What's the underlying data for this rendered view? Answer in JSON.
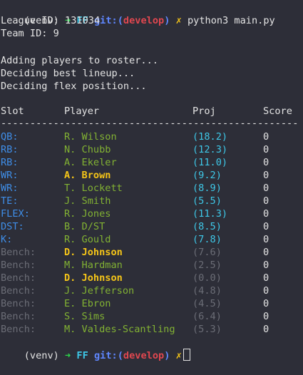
{
  "colors": {
    "background": "#2d2e38",
    "text": "#e4e4e4",
    "slot_active": "#3f8ee8",
    "slot_bench": "#6b6d76",
    "player_normal": "#82b233",
    "player_highlight": "#f5c518",
    "proj_active": "#3ec8e8",
    "proj_bench": "#6b6d76"
  },
  "prompt": {
    "venv": "(venv)",
    "arrow": "➜",
    "dir": "FF",
    "git_prefix": "git:(",
    "branch": "develop",
    "git_suffix": ")",
    "dirty": "✗",
    "command": "python3 main.py"
  },
  "info": {
    "league": "League ID: 131034",
    "team": "Team ID: 9"
  },
  "messages": [
    "Adding players to roster...",
    "Deciding best lineup...",
    "Deciding flex position..."
  ],
  "table": {
    "headers": {
      "slot": "Slot",
      "player": "Player",
      "proj": "Proj",
      "score": "Score"
    },
    "separator": "----------------------------------------------------",
    "rows": [
      {
        "slot": "QB:",
        "player": "R. Wilson",
        "proj": "(18.2)",
        "score": "0",
        "bench": false,
        "highlight": false
      },
      {
        "slot": "RB:",
        "player": "N. Chubb",
        "proj": "(12.3)",
        "score": "0",
        "bench": false,
        "highlight": false
      },
      {
        "slot": "RB:",
        "player": "A. Ekeler",
        "proj": "(11.0)",
        "score": "0",
        "bench": false,
        "highlight": false
      },
      {
        "slot": "WR:",
        "player": "A. Brown",
        "proj": "(9.2)",
        "score": "0",
        "bench": false,
        "highlight": true
      },
      {
        "slot": "WR:",
        "player": "T. Lockett",
        "proj": "(8.9)",
        "score": "0",
        "bench": false,
        "highlight": false
      },
      {
        "slot": "TE:",
        "player": "J. Smith",
        "proj": "(5.5)",
        "score": "0",
        "bench": false,
        "highlight": false
      },
      {
        "slot": "FLEX:",
        "player": "R. Jones",
        "proj": "(11.3)",
        "score": "0",
        "bench": false,
        "highlight": false
      },
      {
        "slot": "DST:",
        "player": "B. D/ST",
        "proj": "(8.5)",
        "score": "0",
        "bench": false,
        "highlight": false
      },
      {
        "slot": "K:",
        "player": "R. Gould",
        "proj": "(7.8)",
        "score": "0",
        "bench": false,
        "highlight": false
      },
      {
        "slot": "Bench:",
        "player": "D. Johnson",
        "proj": "(7.6)",
        "score": "0",
        "bench": true,
        "highlight": true
      },
      {
        "slot": "Bench:",
        "player": "M. Hardman",
        "proj": "(2.5)",
        "score": "0",
        "bench": true,
        "highlight": false
      },
      {
        "slot": "Bench:",
        "player": "D. Johnson",
        "proj": "(0.0)",
        "score": "0",
        "bench": true,
        "highlight": true
      },
      {
        "slot": "Bench:",
        "player": "J. Jefferson",
        "proj": "(4.8)",
        "score": "0",
        "bench": true,
        "highlight": false
      },
      {
        "slot": "Bench:",
        "player": "E. Ebron",
        "proj": "(4.5)",
        "score": "0",
        "bench": true,
        "highlight": false
      },
      {
        "slot": "Bench:",
        "player": "S. Sims",
        "proj": "(6.4)",
        "score": "0",
        "bench": true,
        "highlight": false
      },
      {
        "slot": "Bench:",
        "player": "M. Valdes-Scantling",
        "proj": "(5.3)",
        "score": "0",
        "bench": true,
        "highlight": false
      }
    ]
  }
}
